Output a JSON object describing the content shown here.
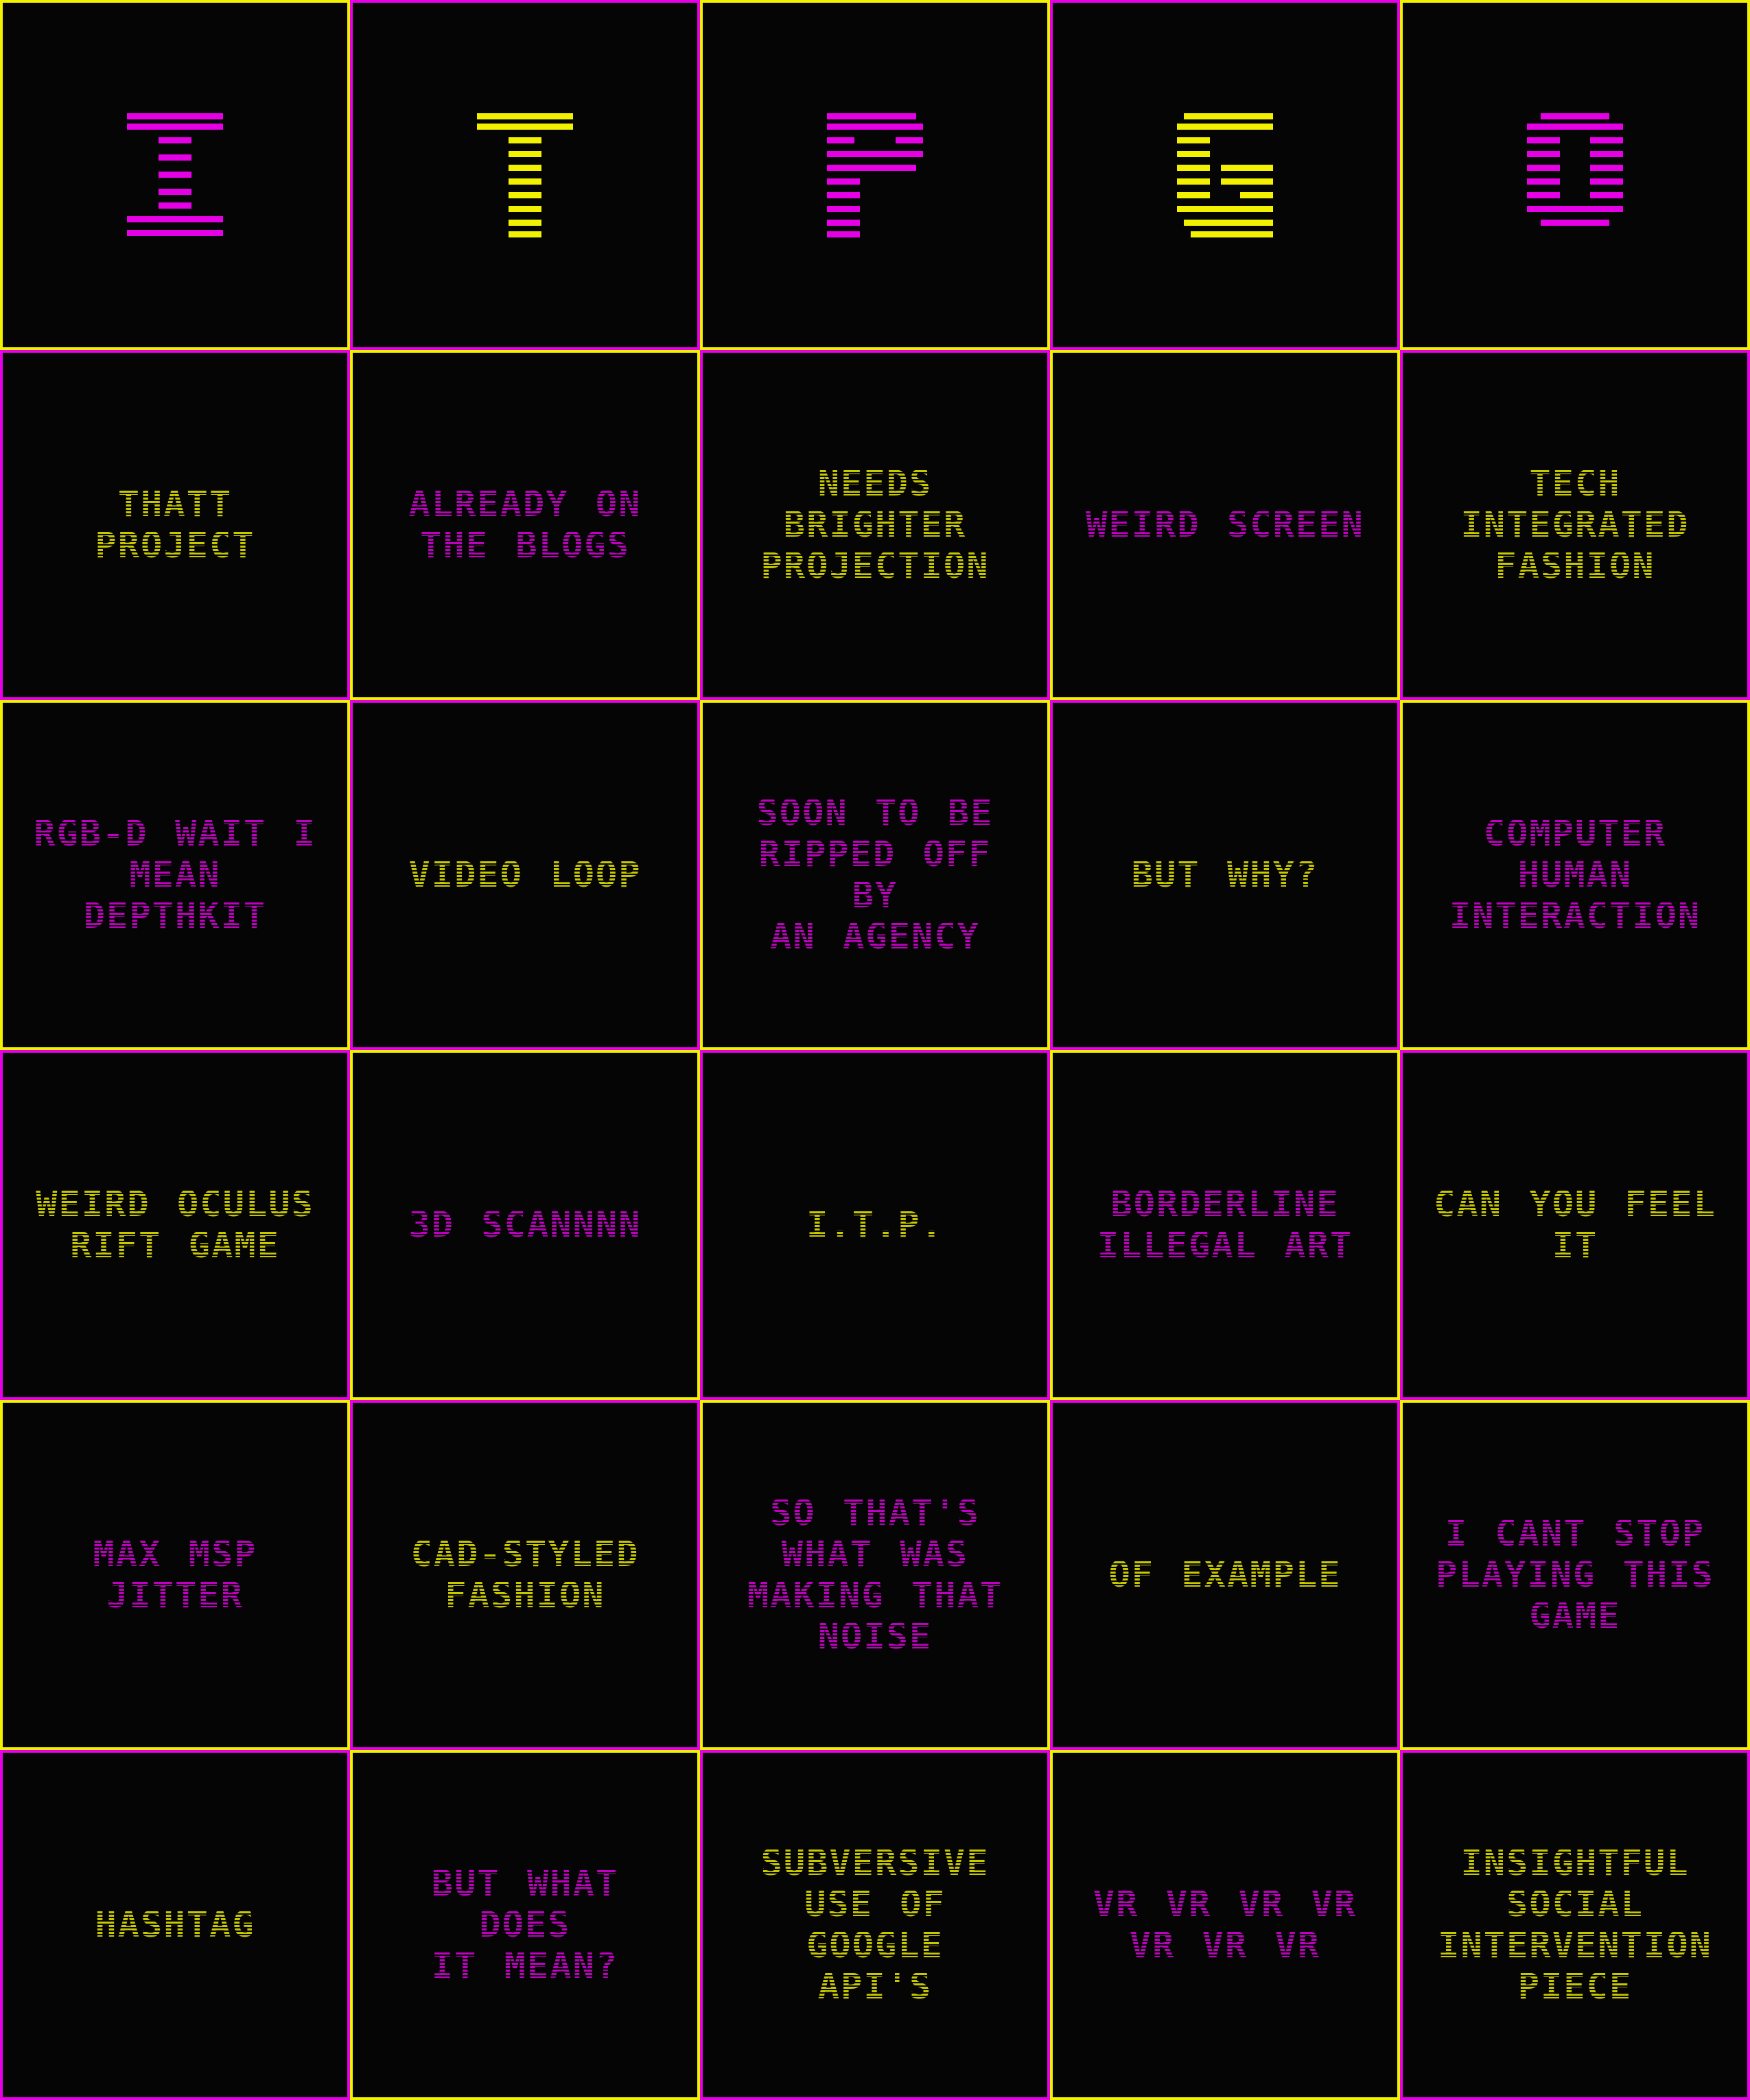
{
  "colors": {
    "magenta": "#e600e6",
    "yellow": "#f2f200",
    "background": "#050505"
  },
  "header": {
    "letters": [
      {
        "char": "I",
        "color": "magenta"
      },
      {
        "char": "T",
        "color": "yellow"
      },
      {
        "char": "P",
        "color": "magenta"
      },
      {
        "char": "G",
        "color": "yellow"
      },
      {
        "char": "O",
        "color": "magenta"
      }
    ]
  },
  "rows": [
    [
      {
        "text": "THATT PROJECT",
        "color": "yellow"
      },
      {
        "text": "ALREADY ON\nTHE BLOGS",
        "color": "magenta"
      },
      {
        "text": "NEEDS\nBRIGHTER\nPROJECTION",
        "color": "yellow"
      },
      {
        "text": "WEIRD SCREEN",
        "color": "magenta"
      },
      {
        "text": "TECH\nINTEGRATED\nFASHION",
        "color": "yellow"
      }
    ],
    [
      {
        "text": "RGB-D WAIT I\nMEAN DEPTHKIT",
        "color": "magenta"
      },
      {
        "text": "VIDEO LOOP",
        "color": "yellow"
      },
      {
        "text": "SOON TO BE\nRIPPED OFF BY\nAN AGENCY",
        "color": "magenta"
      },
      {
        "text": "BUT WHY?",
        "color": "yellow"
      },
      {
        "text": "COMPUTER\nHUMAN\nINTERACTION",
        "color": "magenta"
      }
    ],
    [
      {
        "text": "WEIRD OCULUS\nRIFT GAME",
        "color": "yellow"
      },
      {
        "text": "3D SCANNNN",
        "color": "magenta"
      },
      {
        "text": "I.T.P.",
        "color": "yellow"
      },
      {
        "text": "BORDERLINE\nILLEGAL ART",
        "color": "magenta"
      },
      {
        "text": "CAN YOU FEEL\nIT",
        "color": "yellow"
      }
    ],
    [
      {
        "text": "MAX MSP\nJITTER",
        "color": "magenta"
      },
      {
        "text": "CAD-STYLED\nFASHION",
        "color": "yellow"
      },
      {
        "text": "SO THAT'S\nWHAT WAS\nMAKING THAT\nNOISE",
        "color": "magenta"
      },
      {
        "text": "OF EXAMPLE",
        "color": "yellow"
      },
      {
        "text": "I CANT STOP\nPLAYING THIS\nGAME",
        "color": "magenta"
      }
    ],
    [
      {
        "text": "HASHTAG",
        "color": "yellow"
      },
      {
        "text": "BUT WHAT DOES\nIT MEAN?",
        "color": "magenta"
      },
      {
        "text": "SUBVERSIVE\nUSE OF GOOGLE\nAPI'S",
        "color": "yellow"
      },
      {
        "text": "VR VR VR VR\nVR VR VR",
        "color": "magenta"
      },
      {
        "text": "INSIGHTFUL\nSOCIAL\nINTERVENTION\nPIECE",
        "color": "yellow"
      }
    ]
  ]
}
